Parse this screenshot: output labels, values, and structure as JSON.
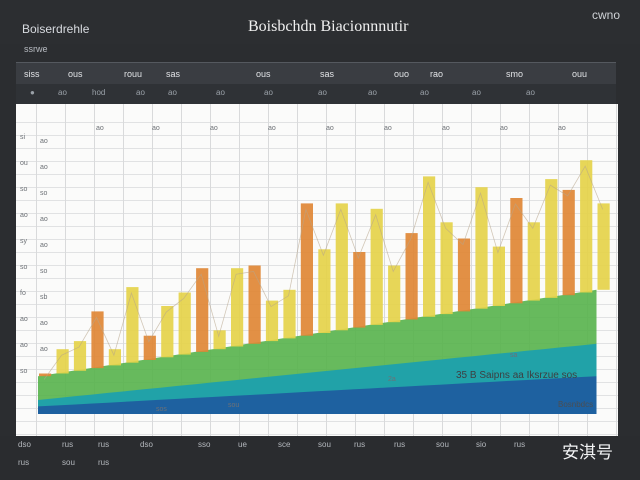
{
  "window": {
    "app_title": "Boiserdrehle",
    "doc_title": "Boisbchdn   Biacionnnutir",
    "corner_label": "cwno",
    "sub_label": "ssrwe"
  },
  "toolbar": {
    "items": [
      "siss",
      "ous",
      "rouu",
      "sas",
      "ous",
      "sas",
      "ouo",
      "rao",
      "smo",
      "ouu"
    ]
  },
  "icon_row": {
    "labels": [
      "ao",
      "hod",
      "ao",
      "ao",
      "ao",
      "ao",
      "ao",
      "ao",
      "ao",
      "ao",
      "ao"
    ]
  },
  "sheet": {
    "column_labels": [
      "ao",
      "ao",
      "ao",
      "ao",
      "ao",
      "ao",
      "ao",
      "ao",
      "ao",
      "ao",
      "ao"
    ],
    "row_labels_left": [
      "si",
      "ou",
      "so",
      "ao",
      "sy",
      "so",
      "fo",
      "ao",
      "ao",
      "so",
      "ao",
      "ao"
    ],
    "row_labels_right": [
      "ao",
      "ao",
      "so",
      "ao",
      "ao",
      "so",
      "sb",
      "ao",
      "ao",
      "ao",
      "ao",
      "ao"
    ],
    "overlay_text": "35 B Saipns aa Iksrzue sos",
    "footer_text": "Bosnbdcs",
    "small_labels": [
      "2a",
      "sou",
      "sos",
      "sa"
    ]
  },
  "chart_data": {
    "type": "bar",
    "title": "",
    "xlabel": "",
    "ylabel": "",
    "ylim": [
      0,
      100
    ],
    "bands": [
      {
        "name": "",
        "values": [
          8,
          9,
          10,
          11,
          12,
          13,
          14,
          15,
          16,
          17,
          18,
          19,
          20,
          21,
          22,
          23,
          24,
          25,
          26,
          27,
          28,
          29,
          30,
          31,
          32,
          33,
          34,
          35,
          36,
          37,
          38,
          39,
          40
        ]
      },
      {
        "name": "",
        "values": [
          14,
          15,
          16,
          17,
          18,
          19,
          20,
          21,
          22,
          23,
          24,
          25,
          26,
          27,
          28,
          29,
          30,
          31,
          32,
          33,
          34,
          35,
          36,
          37,
          38,
          39,
          40,
          41,
          42,
          43,
          44,
          45,
          46
        ]
      }
    ],
    "series": [
      {
        "name": "",
        "values": [
          15,
          24,
          27,
          38,
          24,
          47,
          29,
          40,
          45,
          54,
          31,
          54,
          55,
          42,
          46,
          78,
          61,
          78,
          60,
          76,
          55,
          67,
          88,
          71,
          65,
          84,
          62,
          80,
          71,
          87,
          83,
          94,
          78
        ]
      }
    ]
  },
  "bottom_panel": {
    "labels": [
      "dso",
      "rus",
      "rus",
      "dso",
      "sso",
      "ue",
      "sce",
      "sou",
      "rus",
      "rus",
      "sou",
      "sio",
      "rus",
      "rus",
      "sou",
      "rus"
    ],
    "watermark": "安淇号"
  },
  "colors": {
    "dark_band": "#1e5a9e",
    "teal_band": "#1aa0b0",
    "green_band": "#56b24b",
    "bar_orange": "#e08735",
    "bar_yellow": "#e5d24a"
  }
}
